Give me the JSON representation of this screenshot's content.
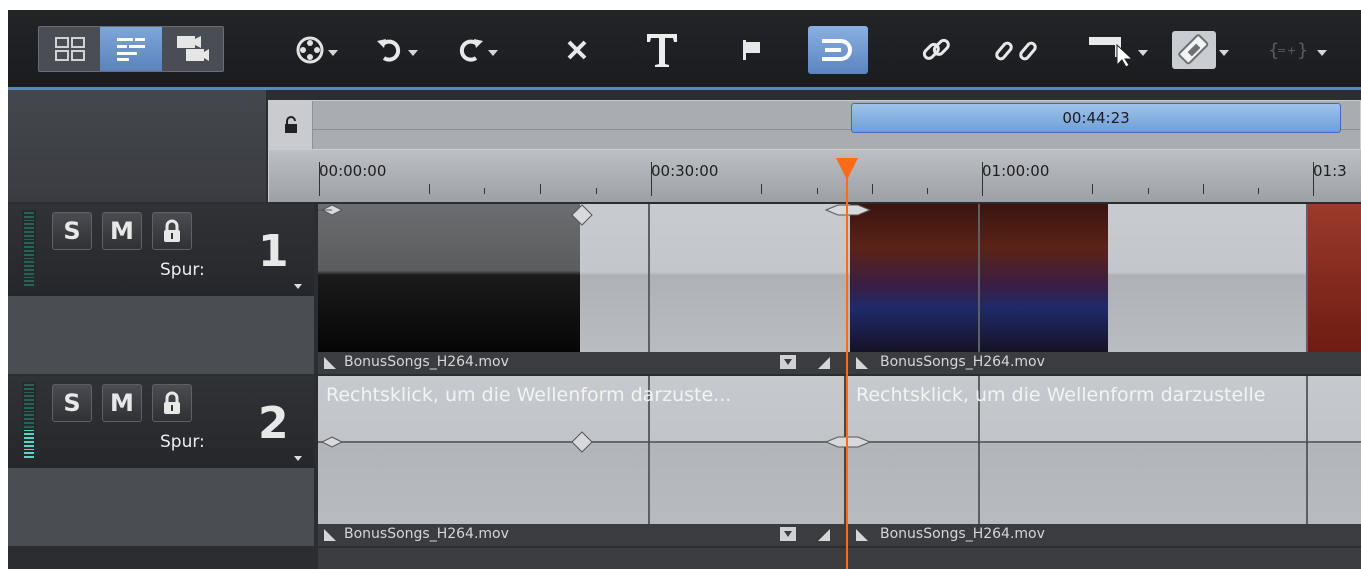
{
  "toolbar": {
    "view_buttons": [
      "storyboard-view",
      "timeline-view",
      "multicam-view"
    ],
    "active_view": "timeline-view",
    "tools": [
      "effects-icon",
      "undo-icon",
      "redo-icon",
      "delete-icon",
      "title-icon",
      "marker-icon",
      "ripple-icon",
      "link-icon",
      "unlink-icon",
      "mouse-mode-icon",
      "razor-icon",
      "group-icon"
    ]
  },
  "overview": {
    "selection_length": "00:44:23"
  },
  "ruler": {
    "labels": [
      "00:00:00",
      "00:30:00",
      "01:00:00",
      "01:3"
    ]
  },
  "tracks": [
    {
      "solo": "S",
      "mute": "M",
      "spur_label": "Spur:",
      "number": "1",
      "clips": [
        "BonusSongs_H264.mov",
        "BonusSongs_H264.mov"
      ]
    },
    {
      "solo": "S",
      "mute": "M",
      "spur_label": "Spur:",
      "number": "2",
      "hint": "Rechtsklick, um die Wellenform darzuste...",
      "hint2": "Rechtsklick, um die Wellenform darzustelle",
      "clips": [
        "BonusSongs_H264.mov",
        "BonusSongs_H264.mov"
      ]
    }
  ],
  "colors": {
    "accent": "#5b86c0",
    "playhead": "#ff6a1a",
    "region": "#7fa8dc"
  }
}
